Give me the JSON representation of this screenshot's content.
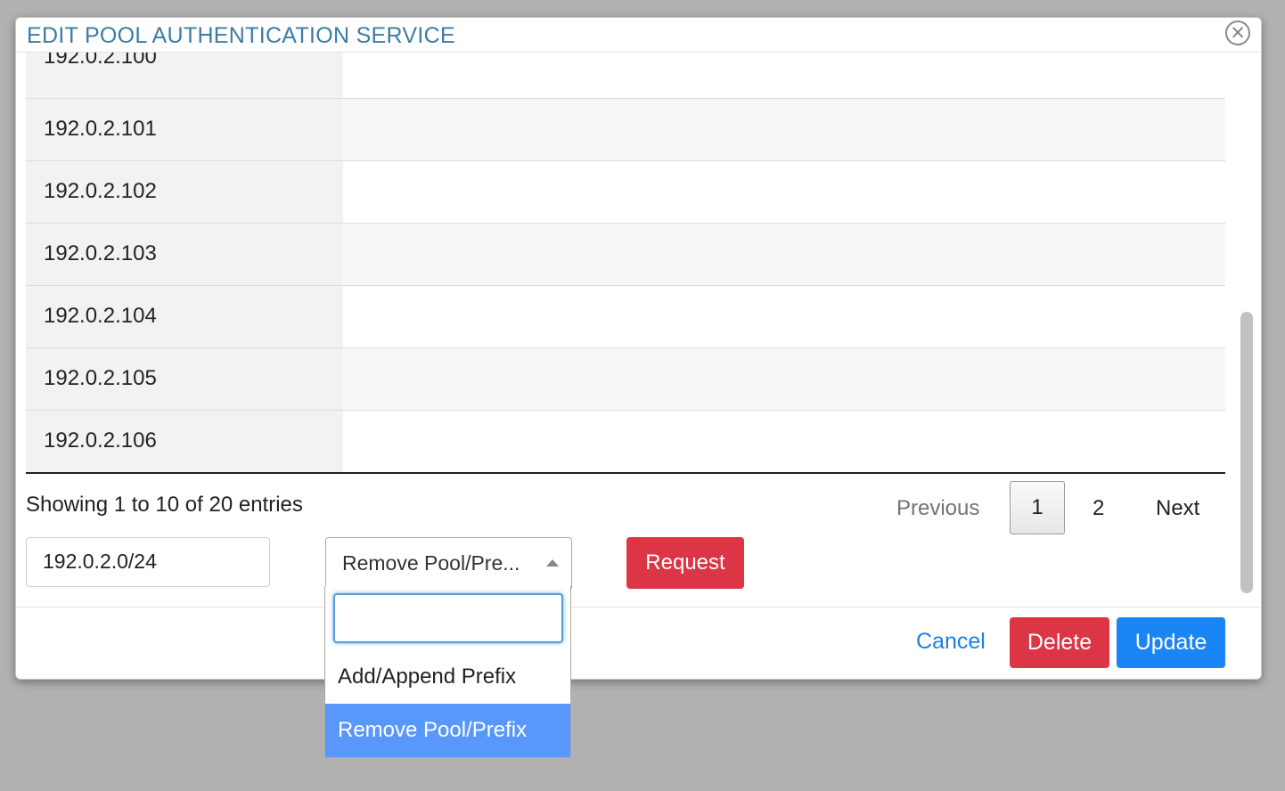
{
  "modal": {
    "title": "EDIT POOL AUTHENTICATION SERVICE",
    "close_symbol": "×"
  },
  "ip_list": [
    "192.0.2.100",
    "192.0.2.101",
    "192.0.2.102",
    "192.0.2.103",
    "192.0.2.104",
    "192.0.2.105",
    "192.0.2.106"
  ],
  "table_info": "Showing 1 to 10 of 20 entries",
  "pagination": {
    "previous": "Previous",
    "pages": [
      "1",
      "2"
    ],
    "current_page": "1",
    "next": "Next"
  },
  "form": {
    "prefix_value": "192.0.2.0/24",
    "action_selected": "Remove Pool/Pre...",
    "request_label": "Request"
  },
  "dropdown": {
    "search_value": "",
    "options": [
      "Add/Append Prefix",
      "Remove Pool/Prefix"
    ],
    "highlighted": "Remove Pool/Prefix"
  },
  "footer": {
    "cancel_label": "Cancel",
    "delete_label": "Delete",
    "update_label": "Update"
  },
  "colors": {
    "title": "#3d7ca4",
    "danger": "#dc3545",
    "primary": "#1a85f5",
    "link": "#1d7fe6",
    "highlight": "#5897fb",
    "overlay": "#b1b1b1"
  },
  "icons": {
    "close": "close-circle-icon",
    "select_arrow": "caret-up-icon"
  }
}
